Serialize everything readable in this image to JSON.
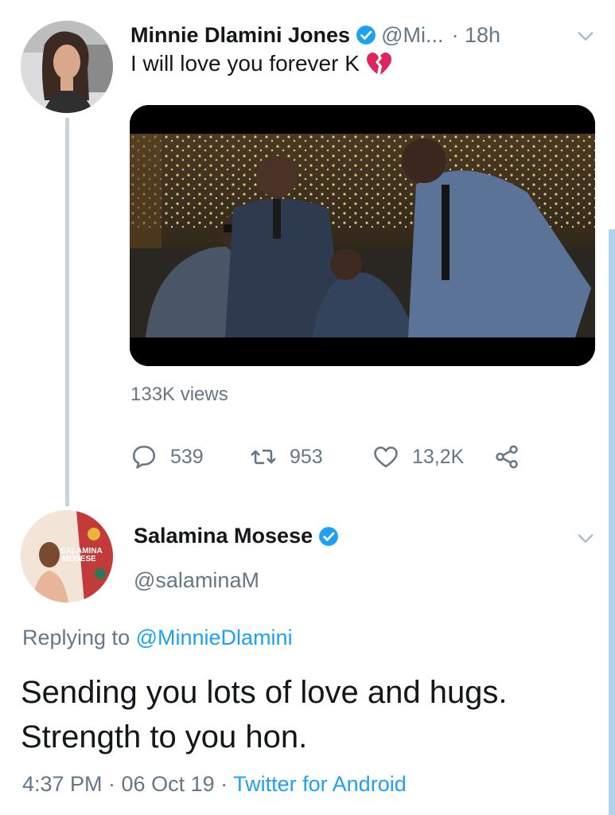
{
  "tweet": {
    "author_name": "Minnie Dlamini Jones",
    "author_handle": "@Mi...",
    "time": "· 18h",
    "text": "I will love you forever K",
    "emoji": "broken-heart-icon",
    "views": "133K views",
    "replies": "539",
    "retweets": "953",
    "likes": "13,2K"
  },
  "reply": {
    "author_name": "Salamina Mosese",
    "author_handle": "@salaminaM",
    "avatar_text_line1": "SALAMINA",
    "avatar_text_line2": "MOSESE",
    "replying_prefix": "Replying to",
    "replying_to": "@MinnieDlamini",
    "text": "Sending you lots of love and hugs. Strength to you hon.",
    "timestamp": "4:37 PM · 06 Oct 19 · ",
    "source": "Twitter for Android"
  },
  "colors": {
    "accent": "#1da1f2",
    "muted": "#657786",
    "text": "#14171a",
    "thread_line": "#c8d3dc"
  }
}
